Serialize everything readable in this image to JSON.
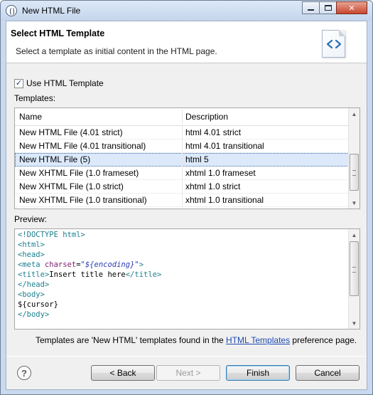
{
  "window": {
    "title": "New HTML File",
    "icon": "eclipse-icon",
    "controls": [
      "minimize-icon",
      "maximize-icon",
      "close-icon"
    ]
  },
  "banner": {
    "title": "Select HTML Template",
    "message": "Select a template as initial content in the HTML page.",
    "icon": "html-file-icon",
    "icon_glyph": "<>"
  },
  "use_template": {
    "label": "Use HTML Template",
    "checked": true,
    "check_glyph": "✓"
  },
  "templates_label": "Templates:",
  "table": {
    "columns": [
      "Name",
      "Description"
    ],
    "rows": [
      {
        "name": "New HTML File (4.01 strict)",
        "description": "html 4.01 strict",
        "selected": false
      },
      {
        "name": "New HTML File (4.01 transitional)",
        "description": "html 4.01 transitional",
        "selected": false
      },
      {
        "name": "New HTML File (5)",
        "description": "html 5",
        "selected": true
      },
      {
        "name": "New XHTML File (1.0 frameset)",
        "description": "xhtml 1.0 frameset",
        "selected": false
      },
      {
        "name": "New XHTML File (1.0 strict)",
        "description": "xhtml 1.0 strict",
        "selected": false
      },
      {
        "name": "New XHTML File (1.0 transitional)",
        "description": "xhtml 1.0 transitional",
        "selected": false
      }
    ]
  },
  "preview_label": "Preview:",
  "preview": {
    "lines": [
      "<!DOCTYPE html>",
      "<html>",
      "<head>",
      "<meta charset=\"${encoding}\">",
      "<title>Insert title here</title>",
      "</head>",
      "<body>",
      "${cursor}",
      "</body>"
    ]
  },
  "footer_note": {
    "before": "Templates are 'New HTML' templates found in the ",
    "link": "HTML Templates",
    "after": " preference page."
  },
  "buttons": {
    "help_glyph": "?",
    "back": "< Back",
    "next": "Next >",
    "finish": "Finish",
    "cancel": "Cancel"
  },
  "colors": {
    "tag": "#1a7f8e",
    "attribute": "#7a1e6e",
    "value": "#2a3cb8",
    "link": "#1f4bb0",
    "selection": "#dbe9fb"
  }
}
